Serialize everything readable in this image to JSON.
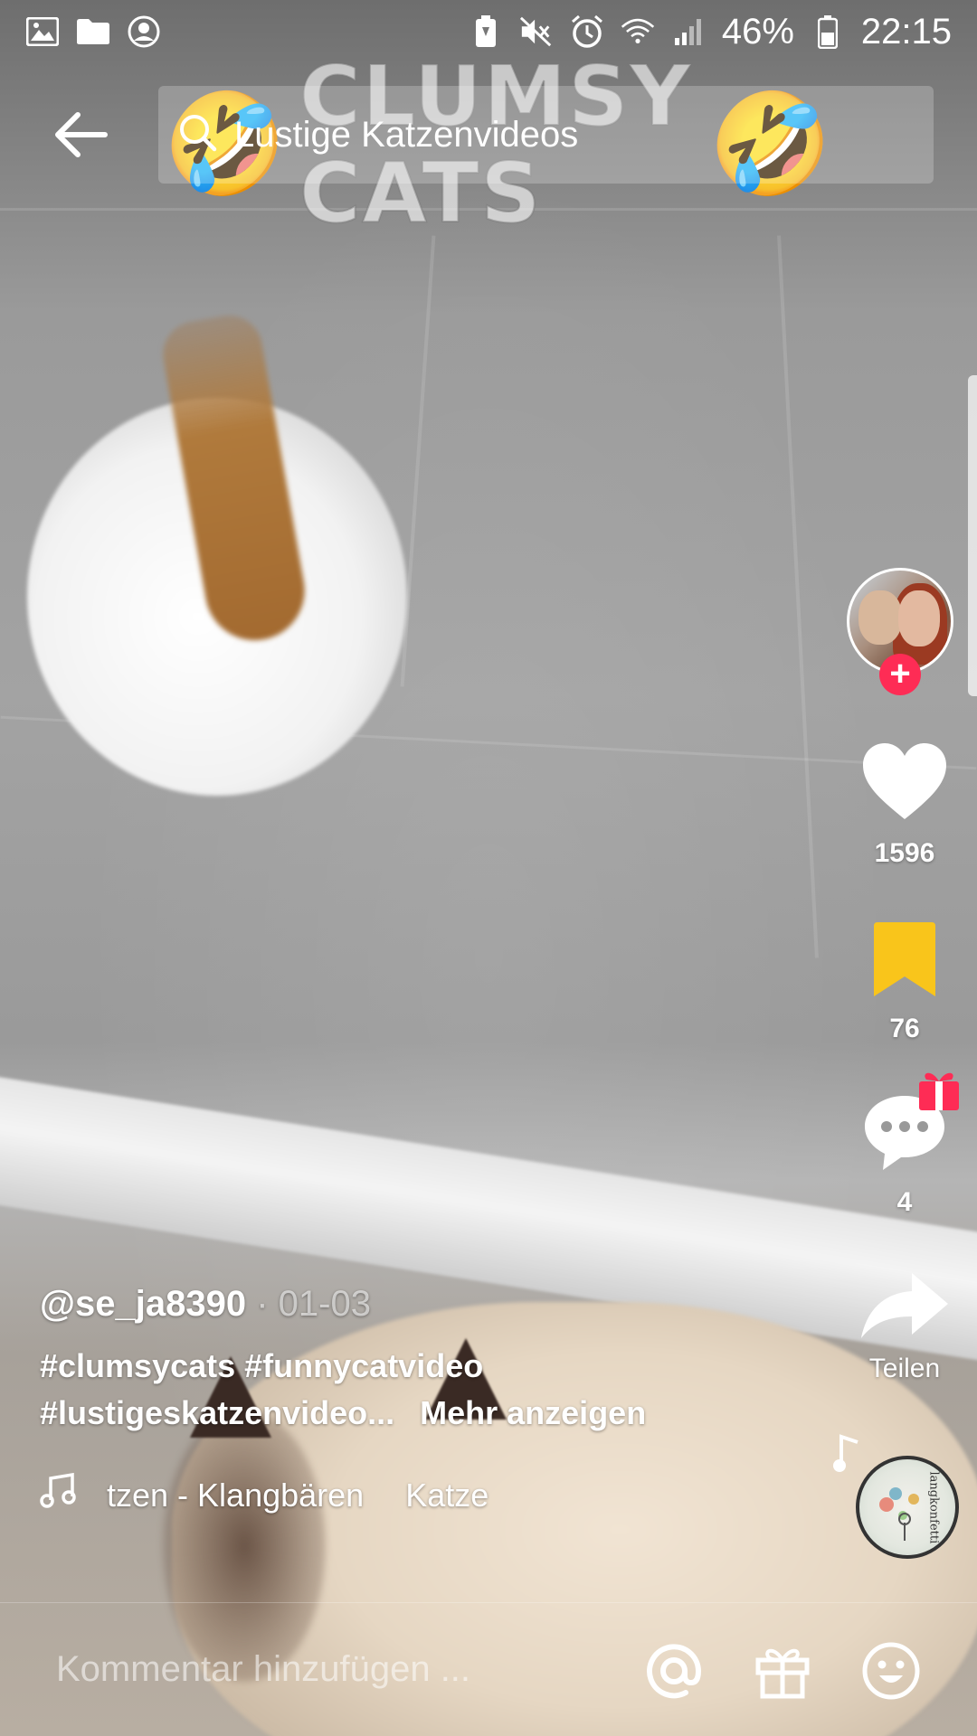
{
  "status_bar": {
    "battery_percent": "46%",
    "time": "22:15",
    "left_icons": [
      "gallery-icon",
      "folder-icon",
      "account-icon"
    ],
    "right_icons": [
      "battery-saver-icon",
      "mute-icon",
      "alarm-icon",
      "wifi-icon",
      "signal-icon",
      "battery-icon"
    ]
  },
  "header": {
    "search_text": "Lustige Katzenvideos",
    "back_icon": "arrow-left-icon",
    "search_icon": "search-icon"
  },
  "video": {
    "overlay_caption": "CLUMSY CATS",
    "overlay_emoji": "🤣"
  },
  "rail": {
    "likes": "1596",
    "favorites": "76",
    "comments": "4",
    "share_label": "Teilen",
    "like_color": "#ffffff",
    "favorite_color": "#f9c51b",
    "follow_color": "#fe2c55",
    "disc_brand": "langkonfetti"
  },
  "post": {
    "username": "@se_ja8390",
    "date": " · 01-03",
    "hashtags_line1": "#clumsycats #funnycatvideo",
    "hashtags_line2": "#lustigeskatzenvideo...",
    "more_label": "Mehr anzeigen",
    "music_title": "tzen - Klangbären",
    "music_tag": "Katze"
  },
  "comment_bar": {
    "placeholder": "Kommentar hinzufügen ...",
    "icons": [
      "mention-icon",
      "gift-icon",
      "emoji-icon"
    ]
  }
}
